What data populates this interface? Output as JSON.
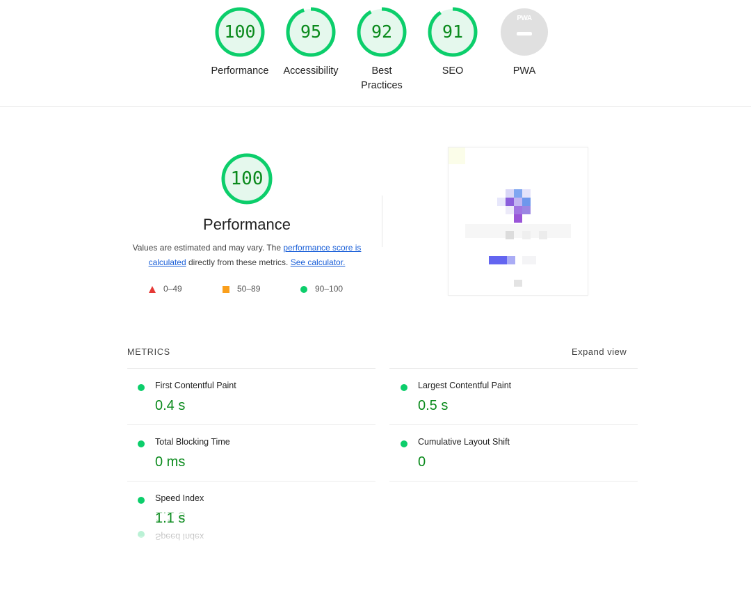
{
  "colors": {
    "pass": "#0cce6b",
    "pass_text": "#0a8a1c",
    "average": "#fa9f1c",
    "fail": "#e53935",
    "pwa_gray": "#e0e0e0",
    "link": "#1a5fd8"
  },
  "categories": [
    {
      "score": "100",
      "label": "Performance",
      "fraction": 1.0
    },
    {
      "score": "95",
      "label": "Accessibility",
      "fraction": 0.95
    },
    {
      "score": "92",
      "label_line1": "Best",
      "label_line2": "Practices",
      "fraction": 0.92
    },
    {
      "score": "91",
      "label": "SEO",
      "fraction": 0.91
    },
    {
      "badge_text": "PWA",
      "label": "PWA"
    }
  ],
  "performance": {
    "score": "100",
    "title": "Performance",
    "desc_prefix": "Values are estimated and may vary. The ",
    "score_link": "performance score is calculated",
    "desc_middle": " directly from these metrics. ",
    "calculator_link": "See calculator.",
    "legend": [
      {
        "icon": "fail-triangle-icon",
        "range": "0–49"
      },
      {
        "icon": "average-square-icon",
        "range": "50–89"
      },
      {
        "icon": "pass-circle-icon",
        "range": "90–100"
      }
    ]
  },
  "metrics": {
    "heading": "METRICS",
    "expand_label": "Expand view",
    "items": [
      {
        "title": "First Contentful Paint",
        "value": "0.4 s"
      },
      {
        "title": "Largest Contentful Paint",
        "value": "0.5 s"
      },
      {
        "title": "Total Blocking Time",
        "value": "0 ms"
      },
      {
        "title": "Cumulative Layout Shift",
        "value": "0"
      },
      {
        "title": "Speed Index",
        "value": "1.1 s"
      }
    ]
  }
}
